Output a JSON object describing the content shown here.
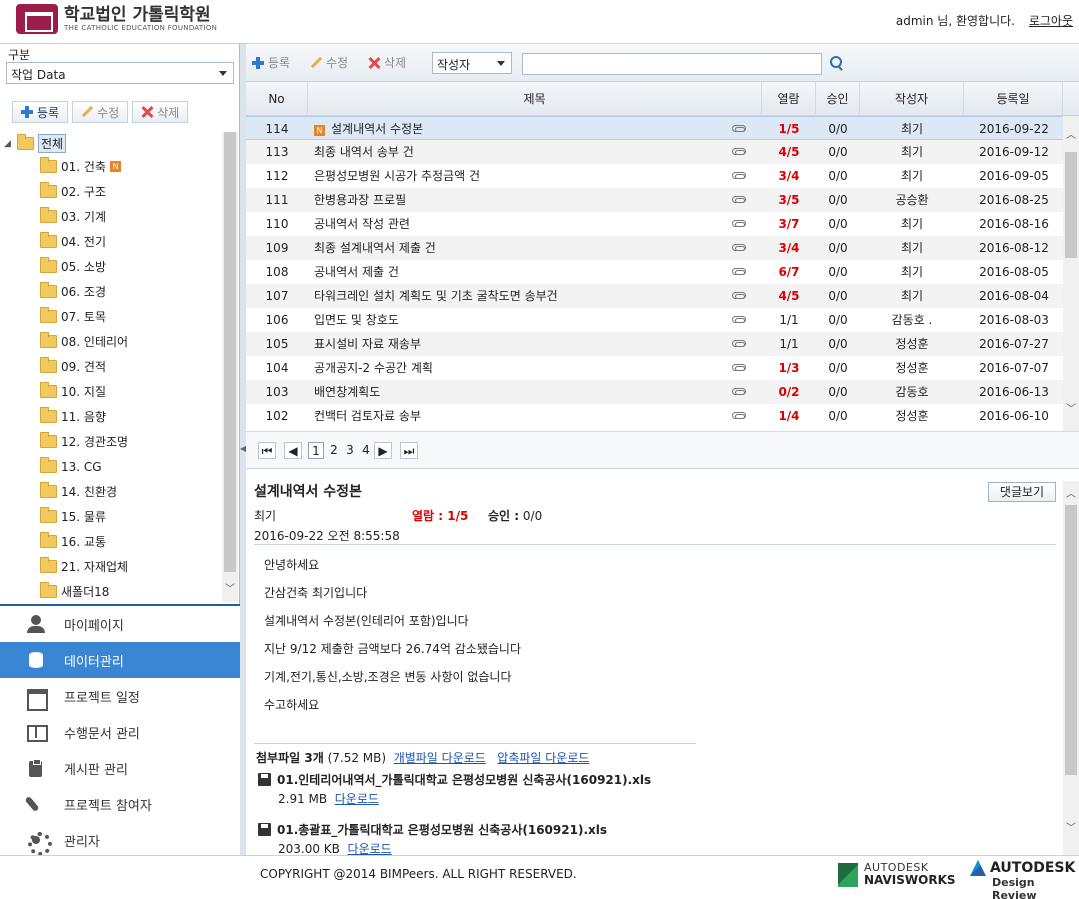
{
  "header": {
    "logo_title": "학교법인 가톨릭학원",
    "logo_subtitle": "THE CATHOLIC EDUCATION FOUNDATION",
    "welcome": "admin 님, 환영합니다.",
    "logout": "로그아웃"
  },
  "left": {
    "category_label": "구분",
    "category_value": "작업 Data",
    "toolbar": {
      "add": "등록",
      "edit": "수정",
      "delete": "삭제"
    },
    "tree_root": "전체",
    "tree_items": [
      {
        "label": "01. 건축",
        "new": true
      },
      {
        "label": "02. 구조"
      },
      {
        "label": "03. 기계"
      },
      {
        "label": "04. 전기"
      },
      {
        "label": "05. 소방"
      },
      {
        "label": "06. 조경"
      },
      {
        "label": "07. 토목"
      },
      {
        "label": "08. 인테리어"
      },
      {
        "label": "09. 견적"
      },
      {
        "label": "10. 지질"
      },
      {
        "label": "11. 음향"
      },
      {
        "label": "12. 경관조명"
      },
      {
        "label": "13. CG"
      },
      {
        "label": "14. 친환경"
      },
      {
        "label": "15. 물류"
      },
      {
        "label": "16. 교통"
      },
      {
        "label": "21. 자재업체"
      },
      {
        "label": "새폴더18"
      }
    ],
    "new_badge": "N"
  },
  "nav": {
    "items": [
      {
        "label": "마이페이지",
        "icon": "user-icon"
      },
      {
        "label": "데이터관리",
        "icon": "database-icon",
        "active": true
      },
      {
        "label": "프로젝트 일정",
        "icon": "calendar-icon"
      },
      {
        "label": "수행문서 관리",
        "icon": "book-icon"
      },
      {
        "label": "게시판 관리",
        "icon": "clipboard-icon"
      },
      {
        "label": "프로젝트 참여자",
        "icon": "phone-icon"
      },
      {
        "label": "관리자",
        "icon": "gear-icon"
      }
    ]
  },
  "main": {
    "toolbar": {
      "add": "등록",
      "edit": "수정",
      "delete": "삭제",
      "author_filter": "작성자",
      "search_value": ""
    },
    "columns": {
      "no": "No",
      "title": "제목",
      "read": "열람",
      "approve": "승인",
      "author": "작성자",
      "date": "등록일"
    },
    "rows": [
      {
        "no": "114",
        "title": "설계내역서 수정본",
        "new": true,
        "read": "1/5",
        "read_red": true,
        "approve": "0/0",
        "author": "최기",
        "date": "2016-09-22",
        "selected": true
      },
      {
        "no": "113",
        "title": "최종 내역서 송부 건",
        "read": "4/5",
        "read_red": true,
        "approve": "0/0",
        "author": "최기",
        "date": "2016-09-12"
      },
      {
        "no": "112",
        "title": "은평성모병원 시공가 추정금액 건",
        "read": "3/4",
        "read_red": true,
        "approve": "0/0",
        "author": "최기",
        "date": "2016-09-05"
      },
      {
        "no": "111",
        "title": "한병용과장 프로필",
        "read": "3/5",
        "read_red": true,
        "approve": "0/0",
        "author": "공승환",
        "date": "2016-08-25"
      },
      {
        "no": "110",
        "title": "공내역서 작성 관련",
        "read": "3/7",
        "read_red": true,
        "approve": "0/0",
        "author": "최기",
        "date": "2016-08-16"
      },
      {
        "no": "109",
        "title": "최종 설계내역서 제출 건",
        "read": "3/4",
        "read_red": true,
        "approve": "0/0",
        "author": "최기",
        "date": "2016-08-12"
      },
      {
        "no": "108",
        "title": "공내역서 제출 건",
        "read": "6/7",
        "read_red": true,
        "approve": "0/0",
        "author": "최기",
        "date": "2016-08-05"
      },
      {
        "no": "107",
        "title": "타워크레인 설치 계획도 및 기초 굴착도면 송부건",
        "read": "4/5",
        "read_red": true,
        "approve": "0/0",
        "author": "최기",
        "date": "2016-08-04"
      },
      {
        "no": "106",
        "title": "입면도 및 창호도",
        "read": "1/1",
        "read_red": false,
        "approve": "0/0",
        "author": "감동호 .",
        "date": "2016-08-03"
      },
      {
        "no": "105",
        "title": "표시설비 자료 재송부",
        "read": "1/1",
        "read_red": false,
        "approve": "0/0",
        "author": "정성훈",
        "date": "2016-07-27"
      },
      {
        "no": "104",
        "title": "공개공지-2 수공간 계획",
        "read": "1/3",
        "read_red": true,
        "approve": "0/0",
        "author": "정성훈",
        "date": "2016-07-07"
      },
      {
        "no": "103",
        "title": "배연창계획도",
        "read": "0/2",
        "read_red": true,
        "approve": "0/0",
        "author": "감동호",
        "date": "2016-06-13"
      },
      {
        "no": "102",
        "title": "컨백터 검토자료 송부",
        "read": "1/4",
        "read_red": true,
        "approve": "0/0",
        "author": "정성훈",
        "date": "2016-06-10"
      }
    ],
    "pager": {
      "pages": [
        "1",
        "2",
        "3",
        "4"
      ],
      "current": "1"
    }
  },
  "detail": {
    "title": "설계내역서 수정본",
    "comment_button": "댓글보기",
    "author": "최기",
    "read_label": "열람 : 1/5",
    "approve_label": "승인 :",
    "approve_value": "0/0",
    "datetime": "2016-09-22 오전 8:55:58",
    "body": [
      "안녕하세요",
      "간삼건축 최기입니다",
      "설계내역서 수정본(인테리어 포함)입니다",
      "지난 9/12 제출한 금액보다 26.74억 감소됐습니다",
      "기계,전기,통신,소방,조경은 변동 사항이 없습니다",
      "수고하세요"
    ],
    "attach_title": "첨부파일 3개",
    "attach_size": "(7.52 MB)",
    "attach_individual": "개별파일 다운로드",
    "attach_zip": "압축파일 다운로드",
    "files": [
      {
        "name": "01.인테리어내역서_가톨릭대학교 은평성모병원 신축공사(160921).xls",
        "size": "2.91 MB",
        "download": "다운로드"
      },
      {
        "name": "01.총괄표_가톨릭대학교 은평성모병원 신축공사(160921).xls",
        "size": "203.00 KB",
        "download": "다운로드"
      }
    ]
  },
  "footer": {
    "copyright": "COPYRIGHT @2014 BIMPeers. ALL RIGHT RESERVED.",
    "navis_line1": "AUTODESK",
    "navis_line2": "NAVISWORKS",
    "adsk_line1": "AUTODESK",
    "adsk_line2": "Design Review"
  },
  "colors": {
    "accent": "#3a86d4",
    "read_red": "#dd0000",
    "selected_row": "#dce8f6"
  }
}
